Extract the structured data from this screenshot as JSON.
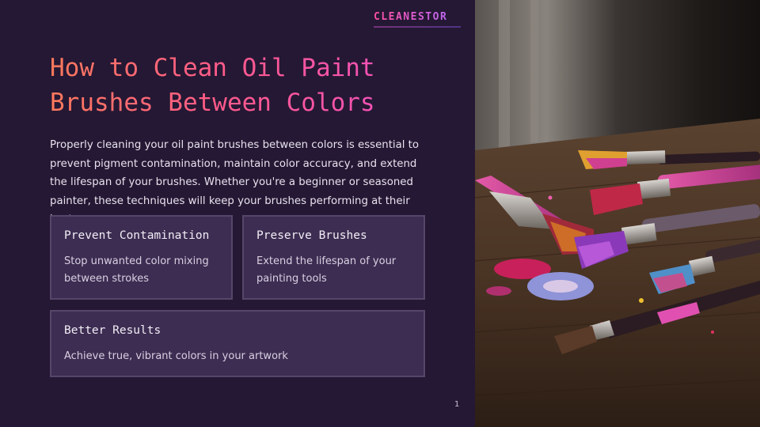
{
  "brand": {
    "name": "CLEANESTOR"
  },
  "slide": {
    "title_line1": "How to Clean Oil Paint",
    "title_line2": "Brushes Between Colors",
    "intro": "Properly cleaning your oil paint brushes between colors is essential to prevent pigment contamination, maintain color accuracy, and extend the lifespan of your brushes. Whether you're a beginner or seasoned painter, these techniques will keep your brushes performing at their best.",
    "page_number": "1"
  },
  "cards": [
    {
      "title": "Prevent Contamination",
      "body": "Stop unwanted color mixing between strokes"
    },
    {
      "title": "Preserve Brushes",
      "body": "Extend the lifespan of your painting tools"
    },
    {
      "title": "Better Results",
      "body": "Achieve true, vibrant colors in your artwork"
    }
  ],
  "colors": {
    "panel_bg": "#251834",
    "card_bg": "#3d2d52",
    "card_border": "#56466a",
    "title_gradient_start": "#ff7a5c",
    "title_gradient_end": "#ee4fc4"
  },
  "photo": {
    "icon": "paintbrushes-photo"
  }
}
